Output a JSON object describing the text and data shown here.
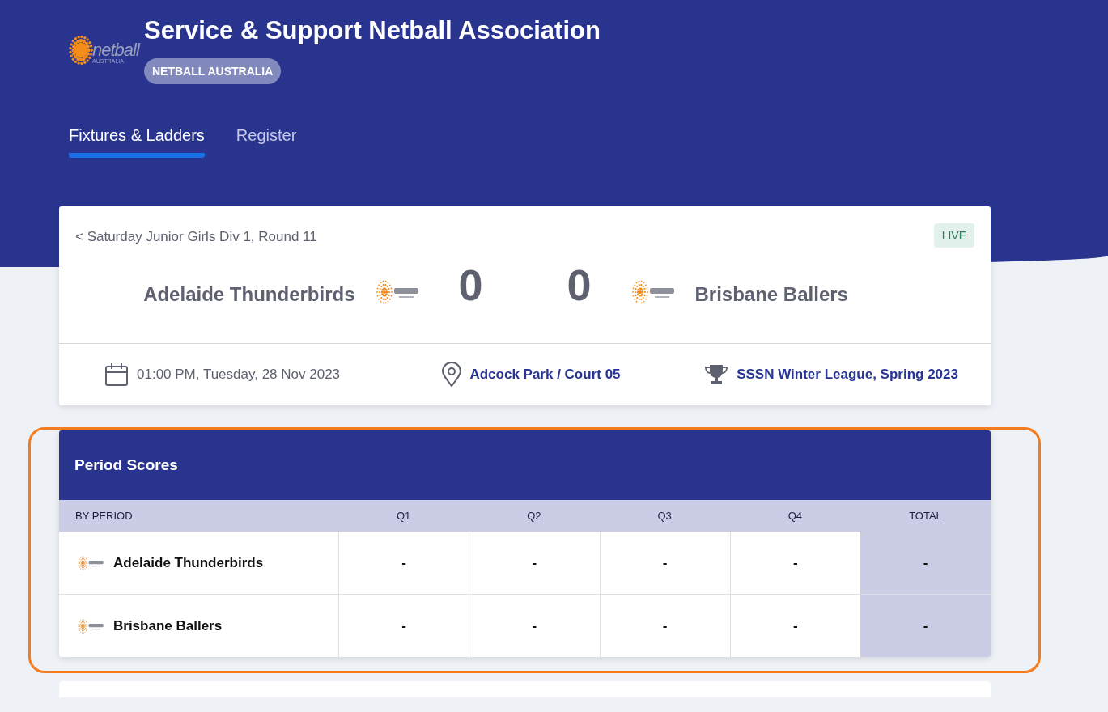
{
  "header": {
    "logo": {
      "word": "netball",
      "sub": "AUSTRALIA"
    },
    "title": "Service & Support Netball Association",
    "badge": "NETBALL AUSTRALIA"
  },
  "tabs": [
    {
      "label": "Fixtures & Ladders",
      "selected": true
    },
    {
      "label": "Register",
      "selected": false
    }
  ],
  "match": {
    "breadcrumb": "< Saturday Junior Girls Div 1, Round 11",
    "status": "LIVE",
    "home": {
      "name": "Adelaide Thunderbirds",
      "score": "0"
    },
    "away": {
      "name": "Brisbane Ballers",
      "score": "0"
    },
    "details": [
      {
        "kind": "date",
        "text": "01:00 PM, Tuesday, 28 Nov 2023"
      },
      {
        "kind": "venue",
        "text": "Adcock Park / Court 05"
      },
      {
        "kind": "competition",
        "text": "SSSN Winter League, Spring 2023"
      }
    ]
  },
  "period_scores": {
    "title": "Period Scores",
    "columns": [
      "BY PERIOD",
      "Q1",
      "Q2",
      "Q3",
      "Q4",
      "TOTAL"
    ],
    "rows": [
      {
        "cells": [
          "Adelaide Thunderbirds",
          "-",
          "-",
          "-",
          "-",
          "-"
        ]
      },
      {
        "cells": [
          "Brisbane Ballers",
          "-",
          "-",
          "-",
          "-",
          "-"
        ]
      }
    ]
  }
}
